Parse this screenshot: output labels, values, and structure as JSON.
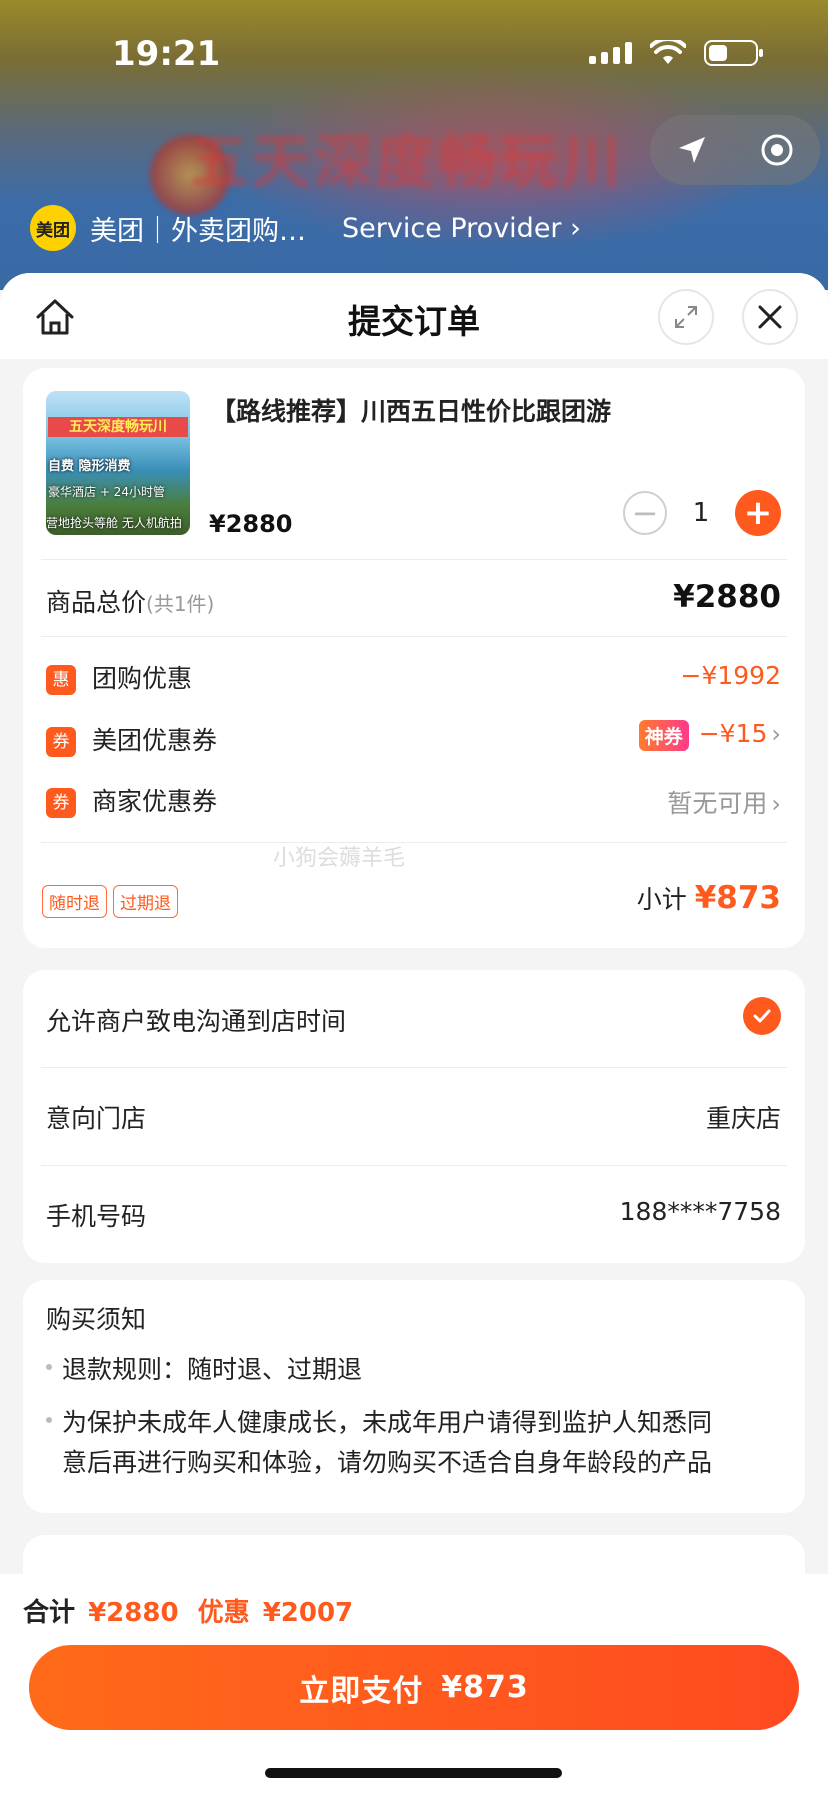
{
  "status": {
    "time": "19:21"
  },
  "header": {
    "app_logo": "美团",
    "app_name": "美团｜外卖团购…",
    "service_provider": "Service Provider",
    "bg_banner_text": "五天深度畅玩川"
  },
  "nav": {
    "title": "提交订单"
  },
  "product": {
    "title": "【路线推荐】川西五日性价比跟团游",
    "price": "¥2880",
    "quantity": "1",
    "thumb": {
      "line1": "五天深度畅玩川",
      "line2": "自费 隐形消费",
      "line3": "豪华酒店 + 24小时管",
      "line4": "营地抢头等舱 无人机航拍"
    }
  },
  "summary": {
    "total_label": "商品总价",
    "total_count": "(共1件)",
    "total_value": "¥2880",
    "discounts": [
      {
        "badge": "惠",
        "label": "团购优惠",
        "value": "−¥1992"
      },
      {
        "badge": "券",
        "label": "美团优惠券",
        "tag": "神券",
        "value": "−¥15"
      },
      {
        "badge": "券",
        "label": "商家优惠券",
        "value": "暂无可用"
      }
    ],
    "watermark": "小狗会薅羊毛",
    "tags": [
      "随时退",
      "过期退"
    ],
    "subtotal_label": "小计",
    "subtotal_value": "¥873"
  },
  "contact": {
    "allow_call_label": "允许商户致电沟通到店时间",
    "store_label": "意向门店",
    "store_value": "重庆店",
    "phone_label": "手机号码",
    "phone_value": "188****7758"
  },
  "notice": {
    "title": "购买须知",
    "refund": "退款规则：随时退、过期退",
    "minor_line1": "为保护未成年人健康成长，未成年用户请得到监护人知悉同",
    "minor_line2": "意后再进行购买和体验，请勿购买不适合自身年龄段的产品"
  },
  "bottom": {
    "total_label": "合计",
    "total_value": "¥2880",
    "discount_label": "优惠",
    "discount_value": "¥2007",
    "pay_label": "立即支付",
    "pay_value": "¥873"
  },
  "colors": {
    "accent": "#ff5a1e",
    "meituan_yellow": "#ffd100"
  }
}
